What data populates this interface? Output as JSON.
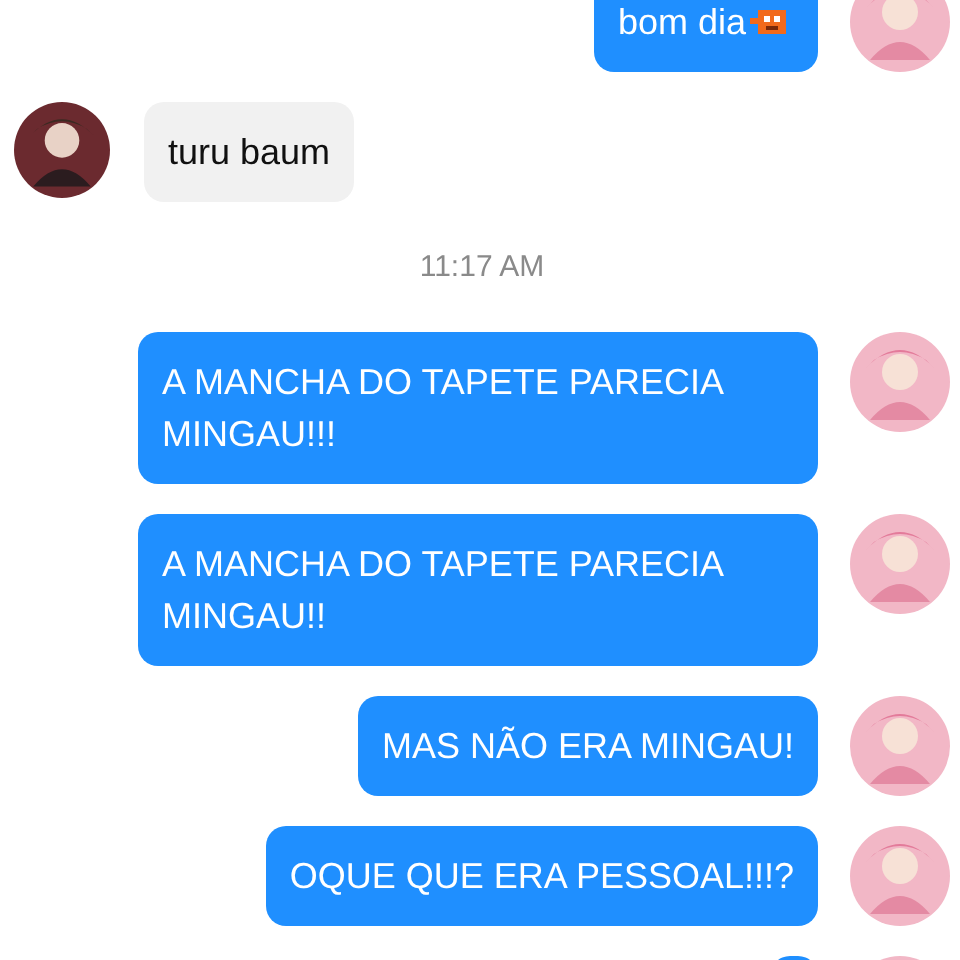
{
  "messages": [
    {
      "kind": "outgoing",
      "text": "bom dia",
      "sticker": true
    },
    {
      "kind": "incoming",
      "text": "turu baum"
    },
    {
      "kind": "time",
      "text": "11:17 AM"
    },
    {
      "kind": "outgoing",
      "text": "A MANCHA DO TAPETE PARECIA MINGAU!!!"
    },
    {
      "kind": "outgoing",
      "text": "A MANCHA DO TAPETE PARECIA MINGAU!!"
    },
    {
      "kind": "outgoing",
      "text": "MAS NÃO ERA MINGAU!"
    },
    {
      "kind": "outgoing",
      "text": "OQUE QUE ERA PESSOAL!!!?"
    },
    {
      "kind": "outgoing"
    }
  ]
}
